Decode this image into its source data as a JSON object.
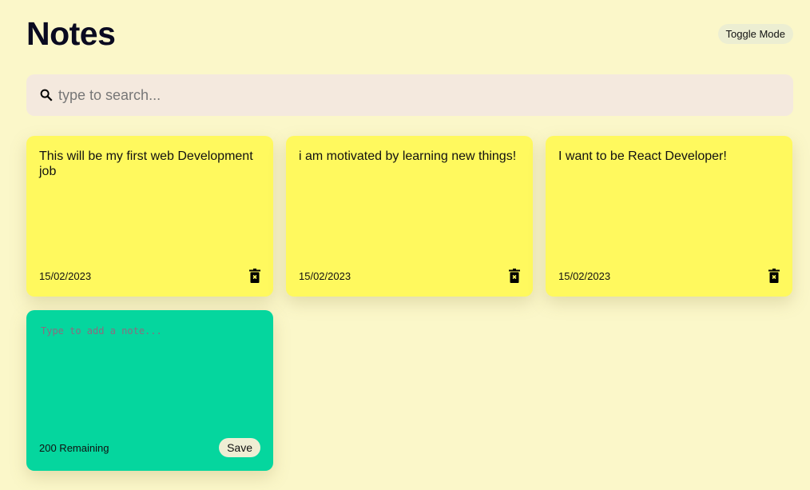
{
  "header": {
    "title": "Notes",
    "toggle_label": "Toggle Mode"
  },
  "search": {
    "placeholder": "type to search...",
    "value": ""
  },
  "notes": [
    {
      "text": "This will be my first web Development job",
      "date": "15/02/2023"
    },
    {
      "text": "i am motivated by learning new things!",
      "date": "15/02/2023"
    },
    {
      "text": "I want to be React Developer!",
      "date": "15/02/2023"
    }
  ],
  "add_note": {
    "placeholder": "Type to add a note...",
    "remaining": "200 Remaining",
    "save_label": "Save"
  },
  "colors": {
    "background": "#fbf7c9",
    "note": "#fff95e",
    "new_note": "#05d69e"
  }
}
